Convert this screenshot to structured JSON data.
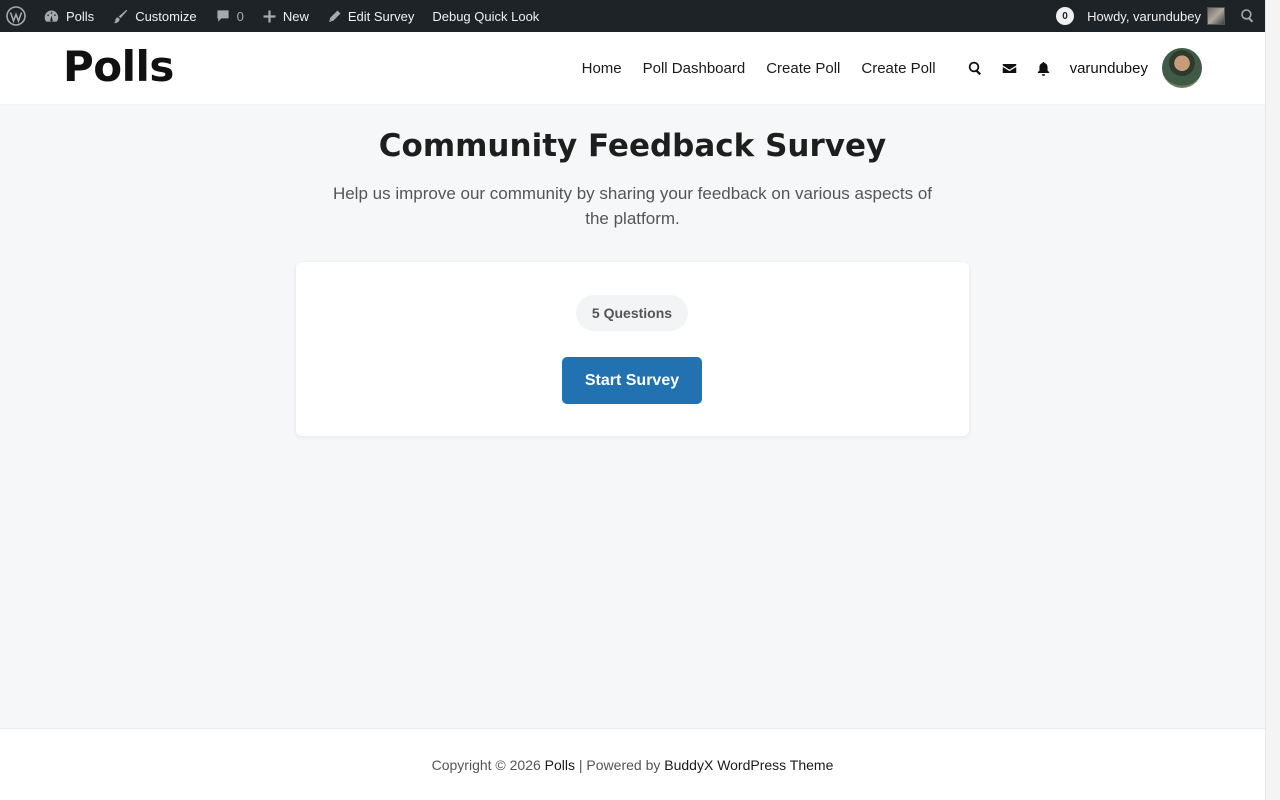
{
  "admin_bar": {
    "site_name": "Polls",
    "customize": "Customize",
    "comments_count": "0",
    "new_label": "New",
    "edit_label": "Edit Survey",
    "debug_label": "Debug Quick Look",
    "notifications_count": "0",
    "greeting": "Howdy, varundubey"
  },
  "header": {
    "logo": "Polls",
    "nav": [
      "Home",
      "Poll Dashboard",
      "Create Poll",
      "Create Poll"
    ],
    "username": "varundubey"
  },
  "survey": {
    "title": "Community Feedback Survey",
    "description": "Help us improve our community by sharing your feedback on various aspects of the platform.",
    "questions_badge": "5 Questions",
    "start_button": "Start Survey"
  },
  "footer": {
    "prefix": "Copyright © 2026 ",
    "site_link": "Polls",
    "middle": " | Powered by ",
    "theme_link": "BuddyX WordPress Theme"
  },
  "colors": {
    "admin_bar_bg": "#1d2327",
    "primary_button": "#2271b1",
    "page_bg": "#f6f7f9"
  }
}
